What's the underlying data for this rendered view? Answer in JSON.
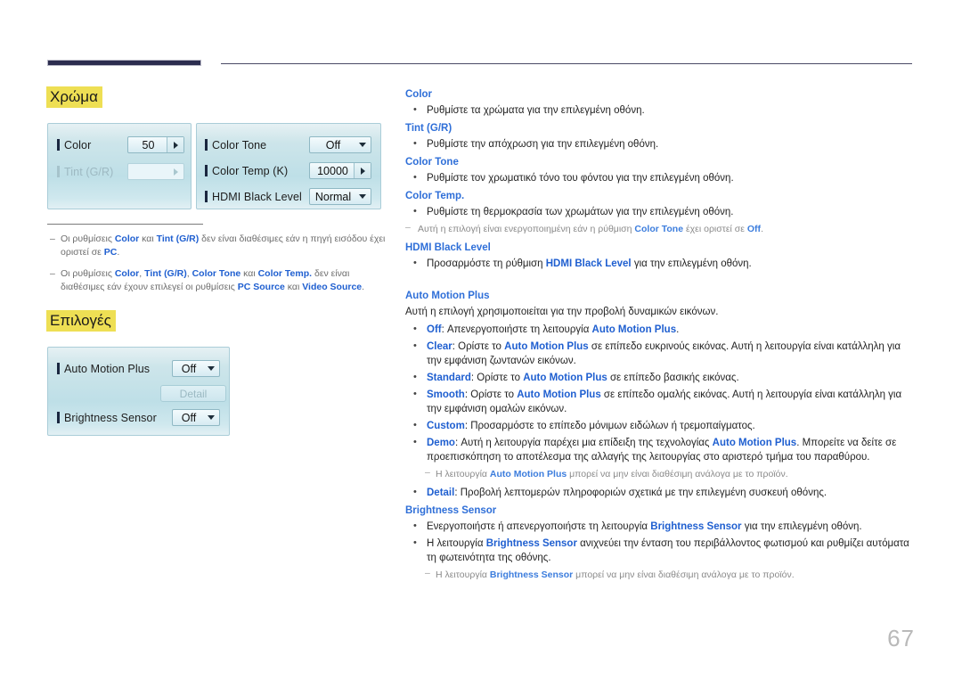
{
  "page": {
    "number": "67",
    "accent_highlight": "#eedf54",
    "link_color": "#2f6fd8",
    "header_bar_color": "#2c2d4f"
  },
  "sections": {
    "chroma_title": "Χρώμα",
    "options_title": "Επιλογές"
  },
  "osd_color_panel": {
    "left": {
      "rows": [
        {
          "label": "Color",
          "value": "50",
          "control": "stepper"
        },
        {
          "label": "Tint (G/R)",
          "value": "",
          "control": "stepper-disabled"
        }
      ]
    },
    "right": {
      "rows": [
        {
          "label": "Color Tone",
          "value": "Off",
          "control": "dropdown"
        },
        {
          "label": "Color Temp (K)",
          "value": "10000",
          "control": "stepper"
        },
        {
          "label": "HDMI Black Level",
          "value": "Normal",
          "control": "dropdown"
        }
      ]
    }
  },
  "osd_options_panel": {
    "rows": [
      {
        "label": "Auto Motion Plus",
        "value": "Off",
        "control": "dropdown"
      },
      {
        "label": "Brightness Sensor",
        "value": "Off",
        "control": "dropdown"
      }
    ],
    "detail_button": "Detail"
  },
  "left_notes": [
    {
      "parts": [
        {
          "t": "Οι ρυθμίσεις ",
          "s": "n"
        },
        {
          "t": "Color",
          "s": "k"
        },
        {
          "t": " και ",
          "s": "n"
        },
        {
          "t": "Tint (G/R)",
          "s": "k"
        },
        {
          "t": " δεν είναι διαθέσιμες εάν η πηγή εισόδου έχει οριστεί σε ",
          "s": "n"
        },
        {
          "t": "PC",
          "s": "k"
        },
        {
          "t": ".",
          "s": "n"
        }
      ]
    },
    {
      "parts": [
        {
          "t": "Οι ρυθμίσεις ",
          "s": "n"
        },
        {
          "t": "Color",
          "s": "k"
        },
        {
          "t": ", ",
          "s": "n"
        },
        {
          "t": "Tint (G/R)",
          "s": "k"
        },
        {
          "t": ", ",
          "s": "n"
        },
        {
          "t": "Color Tone",
          "s": "k"
        },
        {
          "t": " και ",
          "s": "n"
        },
        {
          "t": "Color Temp.",
          "s": "k"
        },
        {
          "t": " δεν είναι διαθέσιμες εάν έχουν επιλεγεί οι ρυθμίσεις ",
          "s": "n"
        },
        {
          "t": "PC Source",
          "s": "k"
        },
        {
          "t": " και ",
          "s": "n"
        },
        {
          "t": "Video Source",
          "s": "k"
        },
        {
          "t": ".",
          "s": "n"
        }
      ]
    }
  ],
  "right_column": {
    "blocks": [
      {
        "kind": "head",
        "text": "Color"
      },
      {
        "kind": "bullet",
        "parts": [
          {
            "t": "Ρυθμίστε τα χρώματα για την επιλεγμένη οθόνη.",
            "s": "n"
          }
        ]
      },
      {
        "kind": "head",
        "text": "Tint (G/R)"
      },
      {
        "kind": "bullet",
        "parts": [
          {
            "t": "Ρυθμίστε την απόχρωση για την επιλεγμένη οθόνη.",
            "s": "n"
          }
        ]
      },
      {
        "kind": "head",
        "text": "Color Tone"
      },
      {
        "kind": "bullet",
        "parts": [
          {
            "t": "Ρυθμίστε τον χρωματικό τόνο του φόντου για την επιλεγμένη οθόνη.",
            "s": "n"
          }
        ]
      },
      {
        "kind": "head",
        "text": "Color Temp."
      },
      {
        "kind": "bullet",
        "parts": [
          {
            "t": "Ρυθμίστε τη θερμοκρασία των χρωμάτων για την επιλεγμένη οθόνη.",
            "s": "n"
          }
        ]
      },
      {
        "kind": "note0",
        "parts": [
          {
            "t": "Αυτή η επιλογή είναι ενεργοποιημένη εάν η ρύθμιση ",
            "s": "n"
          },
          {
            "t": "Color Tone",
            "s": "k"
          },
          {
            "t": " έχει οριστεί σε ",
            "s": "n"
          },
          {
            "t": "Off",
            "s": "k"
          },
          {
            "t": ".",
            "s": "n"
          }
        ]
      },
      {
        "kind": "head",
        "text": "HDMI Black Level"
      },
      {
        "kind": "bullet",
        "parts": [
          {
            "t": "Προσαρμόστε τη ρύθμιση ",
            "s": "n"
          },
          {
            "t": "HDMI Black Level",
            "s": "k"
          },
          {
            "t": " για την επιλεγμένη οθόνη.",
            "s": "n"
          }
        ]
      },
      {
        "kind": "gap-m"
      },
      {
        "kind": "head",
        "text": "Auto Motion Plus"
      },
      {
        "kind": "para",
        "parts": [
          {
            "t": "Αυτή η επιλογή χρησιμοποιείται για την προβολή δυναμικών εικόνων.",
            "s": "n"
          }
        ]
      },
      {
        "kind": "bullet",
        "parts": [
          {
            "t": "Off",
            "s": "k"
          },
          {
            "t": ": Απενεργοποιήστε τη λειτουργία ",
            "s": "n"
          },
          {
            "t": "Auto Motion Plus",
            "s": "k"
          },
          {
            "t": ".",
            "s": "n"
          }
        ]
      },
      {
        "kind": "bullet",
        "parts": [
          {
            "t": "Clear",
            "s": "k"
          },
          {
            "t": ": Ορίστε το ",
            "s": "n"
          },
          {
            "t": "Auto Motion Plus",
            "s": "k"
          },
          {
            "t": " σε επίπεδο ευκρινούς εικόνας. Αυτή η λειτουργία είναι κατάλληλη για την εμφάνιση ζωντανών εικόνων.",
            "s": "n"
          }
        ]
      },
      {
        "kind": "bullet",
        "parts": [
          {
            "t": "Standard",
            "s": "k"
          },
          {
            "t": ": Ορίστε το ",
            "s": "n"
          },
          {
            "t": "Auto Motion Plus",
            "s": "k"
          },
          {
            "t": " σε επίπεδο βασικής εικόνας.",
            "s": "n"
          }
        ]
      },
      {
        "kind": "bullet",
        "parts": [
          {
            "t": "Smooth",
            "s": "k"
          },
          {
            "t": ": Ορίστε το ",
            "s": "n"
          },
          {
            "t": "Auto Motion Plus",
            "s": "k"
          },
          {
            "t": " σε επίπεδο ομαλής εικόνας. Αυτή η λειτουργία είναι κατάλληλη για την εμφάνιση ομαλών εικόνων.",
            "s": "n"
          }
        ]
      },
      {
        "kind": "bullet",
        "parts": [
          {
            "t": "Custom",
            "s": "k"
          },
          {
            "t": ": Προσαρμόστε το επίπεδο μόνιμων ειδώλων ή τρεμοπαίγματος.",
            "s": "n"
          }
        ]
      },
      {
        "kind": "bullet",
        "parts": [
          {
            "t": "Demo",
            "s": "k"
          },
          {
            "t": ": Αυτή η λειτουργία παρέχει μια επίδειξη της τεχνολογίας ",
            "s": "n"
          },
          {
            "t": "Auto Motion Plus",
            "s": "k"
          },
          {
            "t": ". Μπορείτε να δείτε σε προεπισκόπηση το αποτέλεσμα της αλλαγής της λειτουργίας στο αριστερό τμήμα του παραθύρου.",
            "s": "n"
          }
        ]
      },
      {
        "kind": "note",
        "parts": [
          {
            "t": "Η λειτουργία ",
            "s": "n"
          },
          {
            "t": "Auto Motion Plus",
            "s": "k"
          },
          {
            "t": " μπορεί να μην είναι διαθέσιμη ανάλογα με το προϊόν.",
            "s": "n"
          }
        ]
      },
      {
        "kind": "bullet",
        "parts": [
          {
            "t": "Detail",
            "s": "k"
          },
          {
            "t": ": Προβολή λεπτομερών πληροφοριών σχετικά με την επιλεγμένη συσκευή οθόνης.",
            "s": "n"
          }
        ]
      },
      {
        "kind": "head",
        "text": "Brightness Sensor"
      },
      {
        "kind": "bullet",
        "parts": [
          {
            "t": "Ενεργοποιήστε ή απενεργοποιήστε τη λειτουργία ",
            "s": "n"
          },
          {
            "t": "Brightness Sensor",
            "s": "k"
          },
          {
            "t": " για την επιλεγμένη οθόνη.",
            "s": "n"
          }
        ]
      },
      {
        "kind": "bullet",
        "parts": [
          {
            "t": "Η λειτουργία ",
            "s": "n"
          },
          {
            "t": "Brightness Sensor",
            "s": "k"
          },
          {
            "t": " ανιχνεύει την ένταση του περιβάλλοντος φωτισμού και ρυθμίζει αυτόματα τη φωτεινότητα της οθόνης.",
            "s": "n"
          }
        ]
      },
      {
        "kind": "note",
        "parts": [
          {
            "t": "Η λειτουργία ",
            "s": "n"
          },
          {
            "t": "Brightness Sensor",
            "s": "k"
          },
          {
            "t": " μπορεί να μην είναι διαθέσιμη ανάλογα με το προϊόν.",
            "s": "n"
          }
        ]
      }
    ]
  }
}
